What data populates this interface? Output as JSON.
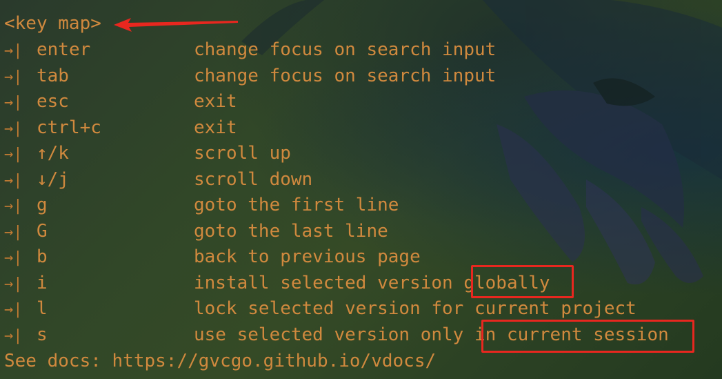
{
  "header": "<key map>",
  "marker": "→|",
  "keymap": [
    {
      "key": "enter",
      "desc": "change focus on search input"
    },
    {
      "key": "tab",
      "desc": "change focus on search input"
    },
    {
      "key": "esc",
      "desc": "exit"
    },
    {
      "key": "ctrl+c",
      "desc": "exit"
    },
    {
      "key": "↑/k",
      "desc": "scroll up"
    },
    {
      "key": "↓/j",
      "desc": "scroll down"
    },
    {
      "key": "g",
      "desc": "goto the first line"
    },
    {
      "key": "G",
      "desc": "goto the last line"
    },
    {
      "key": "b",
      "desc": "back to previous page"
    },
    {
      "key": "i",
      "desc": "install selected version globally"
    },
    {
      "key": "l",
      "desc": "lock selected version for current project"
    },
    {
      "key": "s",
      "desc": "use selected version only in current session"
    }
  ],
  "footer": "See docs: https://gvcgo.github.io/vdocs/",
  "colors": {
    "text": "#d0893e",
    "highlight": "#e8271f"
  },
  "annotations": {
    "arrow": "red-arrow-icon",
    "boxes": [
      "globally",
      "in current session"
    ]
  }
}
